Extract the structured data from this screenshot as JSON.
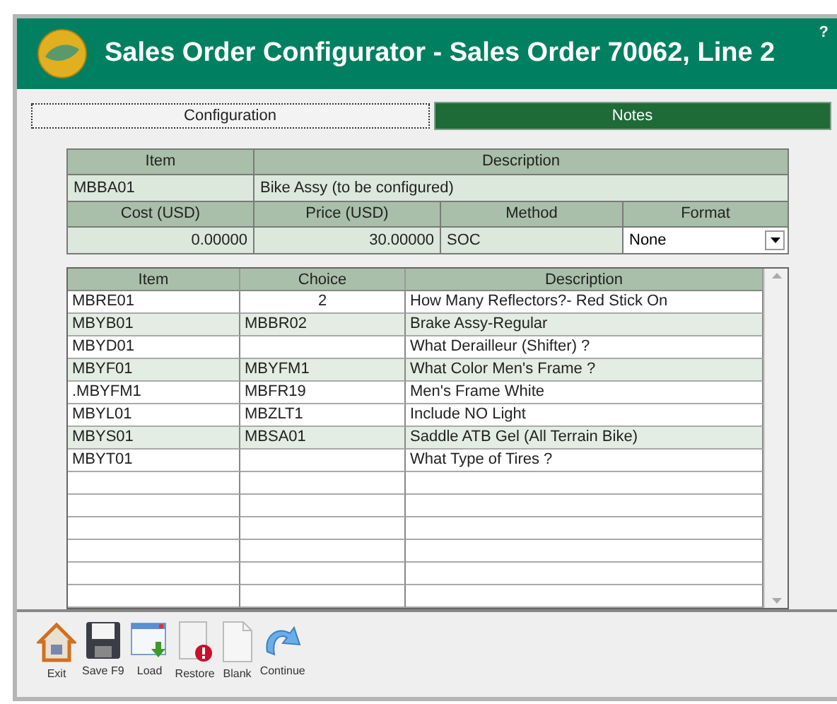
{
  "window": {
    "title": "Sales Order Configurator - Sales Order 70062, Line 2",
    "help": "?"
  },
  "tabs": [
    {
      "label": "Configuration",
      "selected": true
    },
    {
      "label": "Notes",
      "selected": false
    }
  ],
  "header_table": {
    "item_label": "Item",
    "description_label": "Description",
    "item": "MBBA01",
    "description": "Bike Assy (to be configured)",
    "cost_label": "Cost (USD)",
    "price_label": "Price (USD)",
    "method_label": "Method",
    "format_label": "Format",
    "cost": "0.00000",
    "price": "30.00000",
    "method": "SOC",
    "format": "None"
  },
  "grid": {
    "columns": [
      "Item",
      "Choice",
      "Description"
    ],
    "rows": [
      {
        "item": "MBRE01",
        "choice": "2",
        "description": "How Many Reflectors?- Red Stick On",
        "highlighted": false
      },
      {
        "item": "MBYB01",
        "choice": "MBBR02",
        "description": "Brake Assy-Regular",
        "highlighted": true
      },
      {
        "item": "MBYD01",
        "choice": "",
        "description": "What Derailleur (Shifter) ?",
        "highlighted": false
      },
      {
        "item": "MBYF01",
        "choice": "MBYFM1",
        "description": "What Color Men's Frame ?",
        "highlighted": true
      },
      {
        "item": ".MBYFM1",
        "choice": "MBFR19",
        "description": "Men's Frame White",
        "highlighted": false
      },
      {
        "item": "MBYL01",
        "choice": "MBZLT1",
        "description": "Include NO Light",
        "highlighted": false
      },
      {
        "item": "MBYS01",
        "choice": "MBSA01",
        "description": "Saddle ATB Gel (All Terrain Bike)",
        "highlighted": true
      },
      {
        "item": "MBYT01",
        "choice": "",
        "description": "What Type of Tires ?",
        "highlighted": false
      }
    ]
  },
  "toolbar": [
    {
      "label": "Exit",
      "kind": "house"
    },
    {
      "label": "Save F9",
      "kind": "disk"
    },
    {
      "label": "Load",
      "kind": "load"
    },
    {
      "label": "Restore",
      "kind": "restore"
    },
    {
      "label": "Blank",
      "kind": "blank"
    },
    {
      "label": "Continue",
      "kind": "continue"
    }
  ]
}
